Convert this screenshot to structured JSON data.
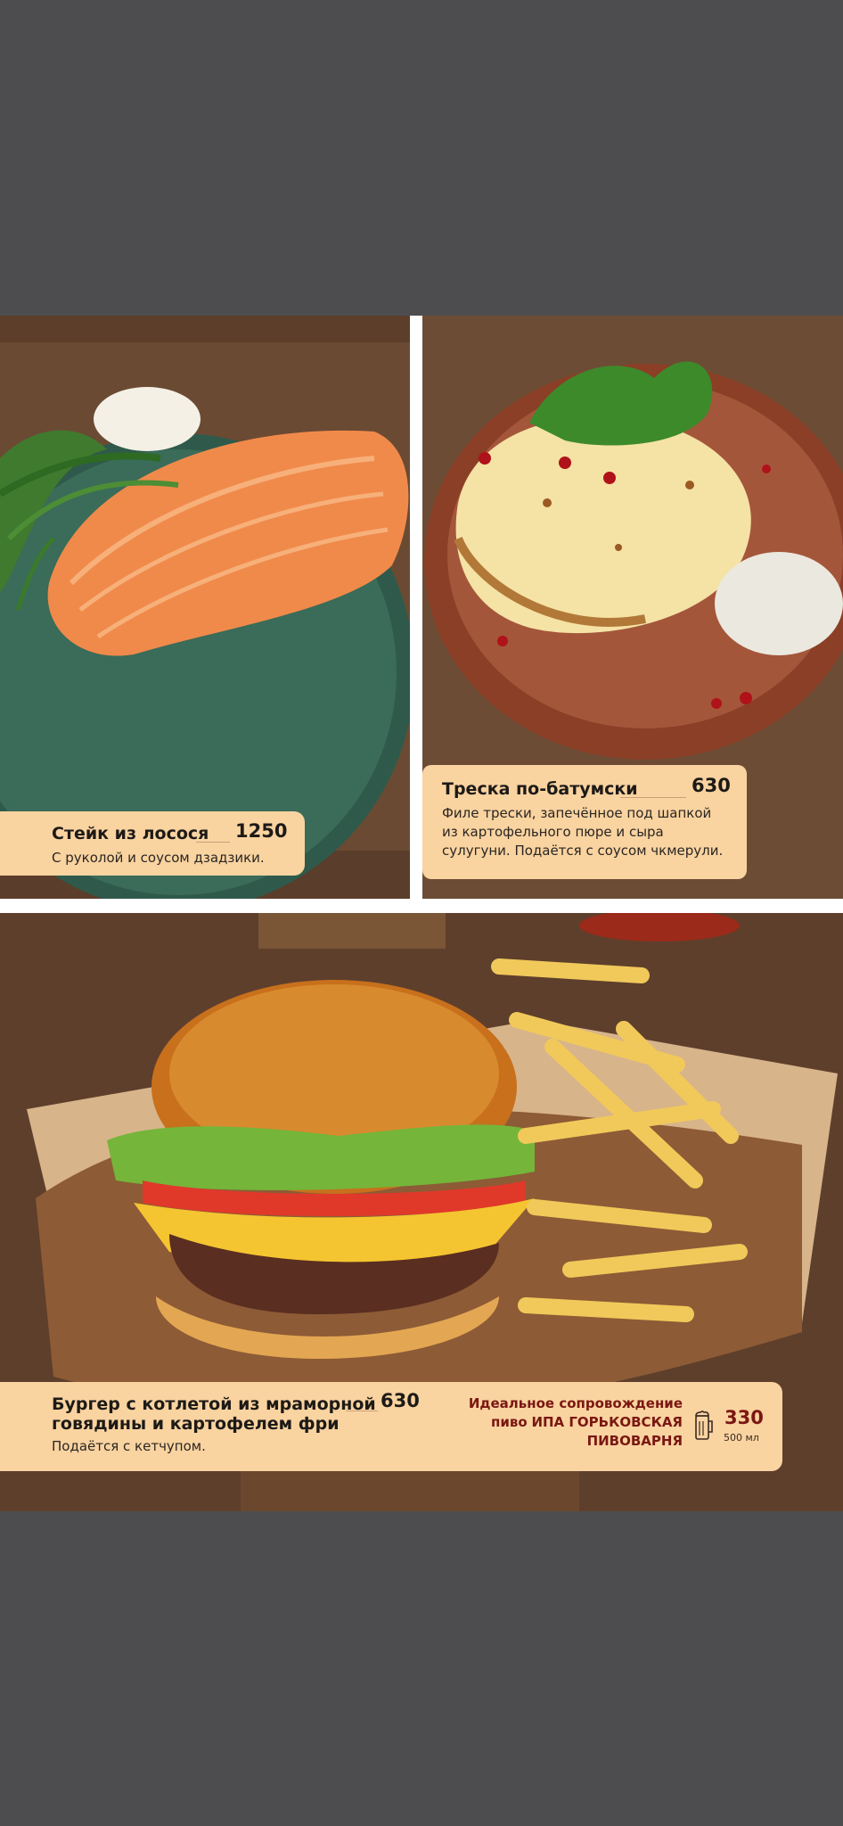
{
  "colors": {
    "background": "#4d4d4f",
    "card": "#f9d3a0",
    "accent": "#7a1712"
  },
  "menu": {
    "items": [
      {
        "title": "Стейк из лосося",
        "price": "1250",
        "description": "С руколой и соусом дзадзики."
      },
      {
        "title": "Треска по-батумски",
        "price": "630",
        "description_lines": [
          "Филе трески, запечённое под шапкой",
          "из картофельного пюре и сыра",
          "сулугуни. Подаётся с соусом чкмерули."
        ]
      },
      {
        "title_lines": [
          "Бургер с котлетой из мраморной",
          "говядины и картофелем фри"
        ],
        "price": "630",
        "description": "Подаётся с кетчупом."
      }
    ],
    "pairing": {
      "label_line1": "Идеальное сопровождение",
      "label_line2_prefix": "пиво",
      "label_line2_name": "ИПА ГОРЬКОВСКАЯ",
      "label_line3": "ПИВОВАРНЯ",
      "icon": "beer-mug-icon",
      "price": "330",
      "volume": "500 мл"
    }
  }
}
